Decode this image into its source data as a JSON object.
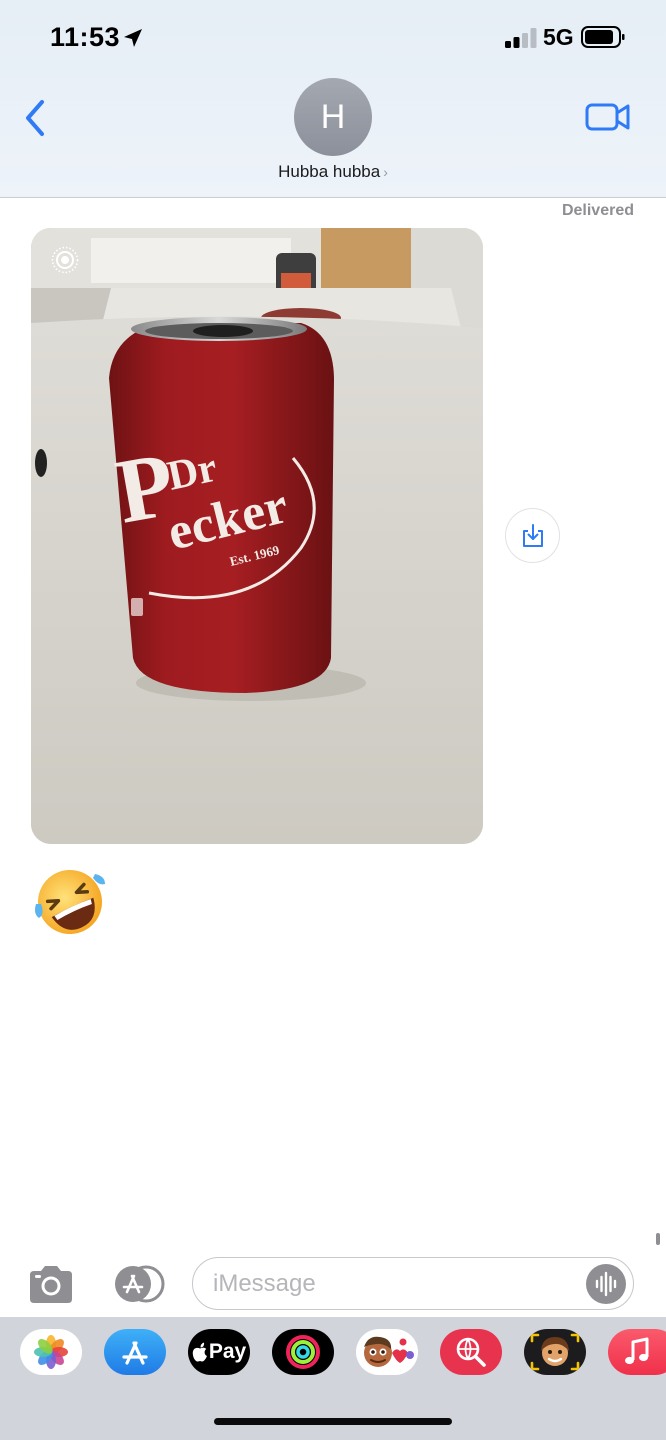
{
  "status_bar": {
    "time": "11:53",
    "network": "5G",
    "signal_bars_filled": 2,
    "signal_bars_total": 4,
    "battery_level": 0.85
  },
  "header": {
    "contact_initial": "H",
    "contact_name": "Hubba hubba",
    "name_chevron": "›",
    "accent_color": "#2f7bf6"
  },
  "conversation": {
    "delivered_label": "Delivered",
    "photo_message": {
      "can_brand_first": "Dr",
      "can_brand_second": "Pecker",
      "can_est": "Est. 1969",
      "live_photo": true
    },
    "emoji_message": "rolling-on-the-floor-laughing"
  },
  "compose": {
    "placeholder": "iMessage"
  },
  "app_drawer": {
    "apple_pay_label": "Pay",
    "apps": [
      "photos",
      "app-store",
      "apple-pay",
      "activity",
      "memoji-stickers",
      "images-search",
      "memoji",
      "music"
    ]
  }
}
